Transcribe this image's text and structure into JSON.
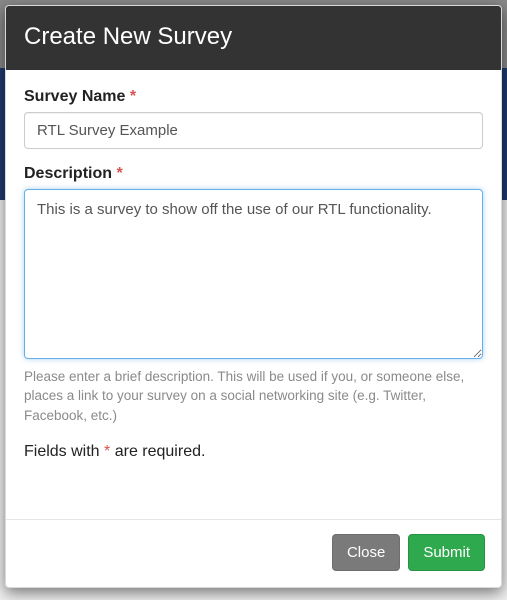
{
  "modal": {
    "title": "Create New Survey"
  },
  "form": {
    "name_label": "Survey Name",
    "name_value": "RTL Survey Example",
    "desc_label": "Description",
    "desc_value": "This is a survey to show off the use of our RTL functionality.",
    "desc_help": "Please enter a brief description. This will be used if you, or someone else, places a link to your survey on a social networking site (e.g. Twitter, Facebook, etc.)",
    "required_asterisk": "*",
    "required_note_prefix": "Fields with ",
    "required_note_suffix": " are required."
  },
  "footer": {
    "close_label": "Close",
    "submit_label": "Submit"
  }
}
